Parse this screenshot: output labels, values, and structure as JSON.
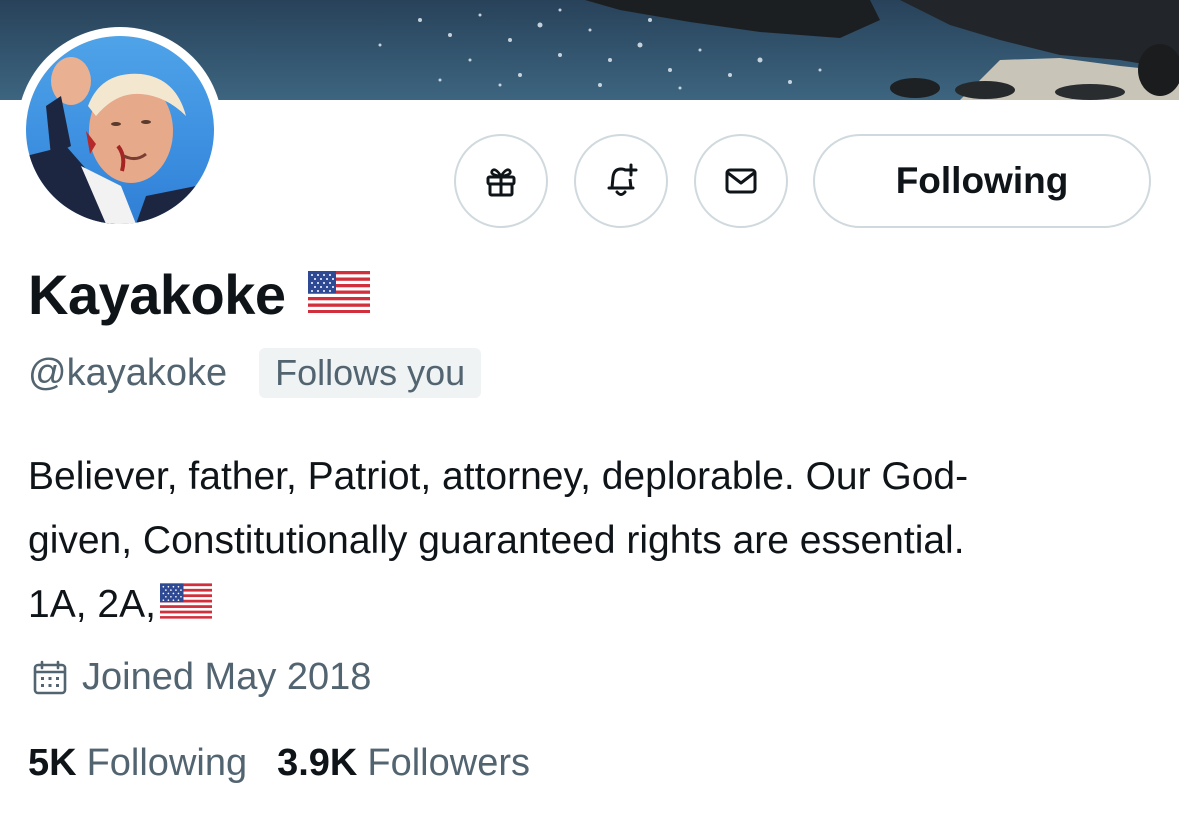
{
  "profile": {
    "display_name": "Kayakoke",
    "name_emoji": "us-flag-emoji",
    "handle": "@kayakoke",
    "follows_you_badge": "Follows you",
    "bio_lines": [
      "Believer, father, Patriot, attorney, deplorable. Our God-",
      "given, Constitutionally guaranteed rights are essential.",
      "1A, 2A,"
    ],
    "bio_trailing_emoji": "us-flag-emoji",
    "joined": "Joined May 2018",
    "stats": {
      "following_count": "5K",
      "following_label": "Following",
      "followers_count": "3.9K",
      "followers_label": "Followers"
    }
  },
  "actions": {
    "gift_icon": "gift-icon",
    "notify_icon": "bell-plus-icon",
    "message_icon": "envelope-icon",
    "follow_state_label": "Following"
  },
  "colors": {
    "text_primary": "#0f1419",
    "text_secondary": "#536471",
    "border": "#cfd9de",
    "badge_bg": "#eff3f4"
  }
}
